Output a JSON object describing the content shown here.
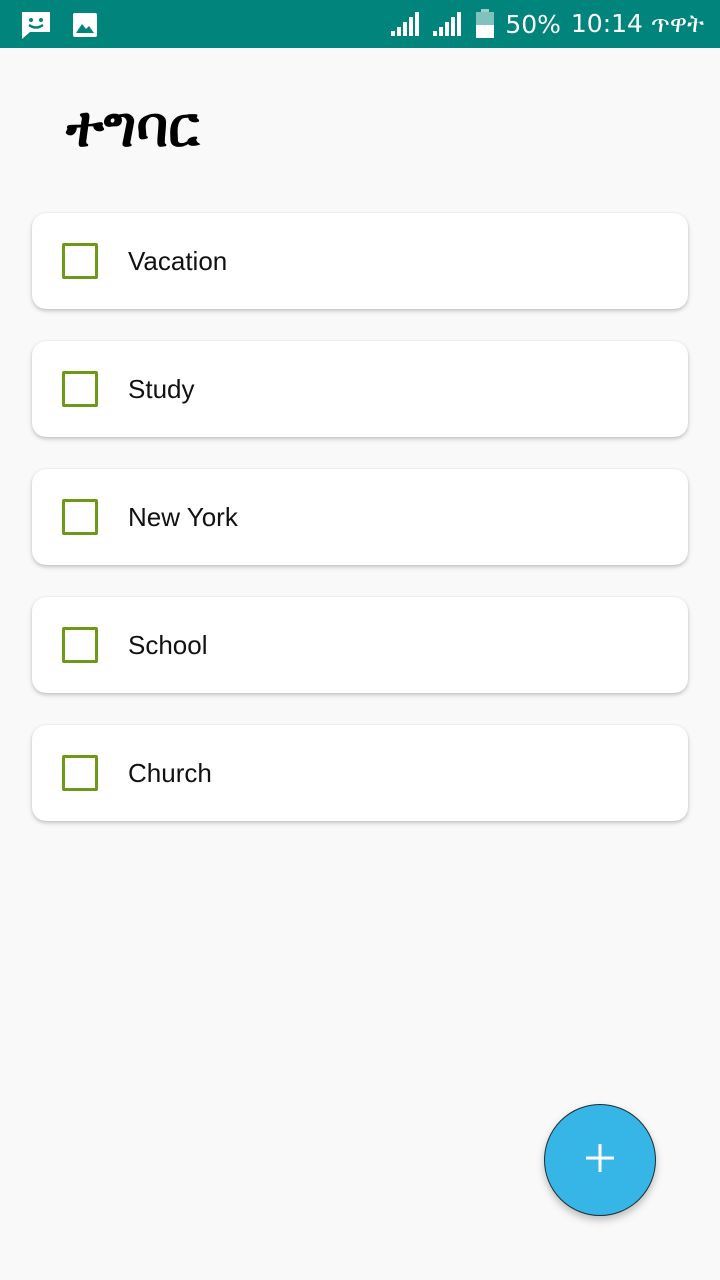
{
  "status_bar": {
    "left_icons": [
      "chat-icon",
      "image-icon"
    ],
    "right_icons": [
      "signal-icon",
      "signal-icon",
      "battery-icon"
    ],
    "battery_percent": "50%",
    "time": "10:14 ጥዋት",
    "background_color": "#00847b"
  },
  "page": {
    "title": "ተግባር"
  },
  "tasks": [
    {
      "label": "Vacation",
      "checked": false
    },
    {
      "label": "Study",
      "checked": false
    },
    {
      "label": "New York",
      "checked": false
    },
    {
      "label": "School",
      "checked": false
    },
    {
      "label": "Church",
      "checked": false
    }
  ],
  "fab": {
    "icon": "plus-icon",
    "color": "#36b5e7"
  },
  "colors": {
    "checkbox_border": "#6a9a16",
    "background": "#f9f9f9"
  }
}
